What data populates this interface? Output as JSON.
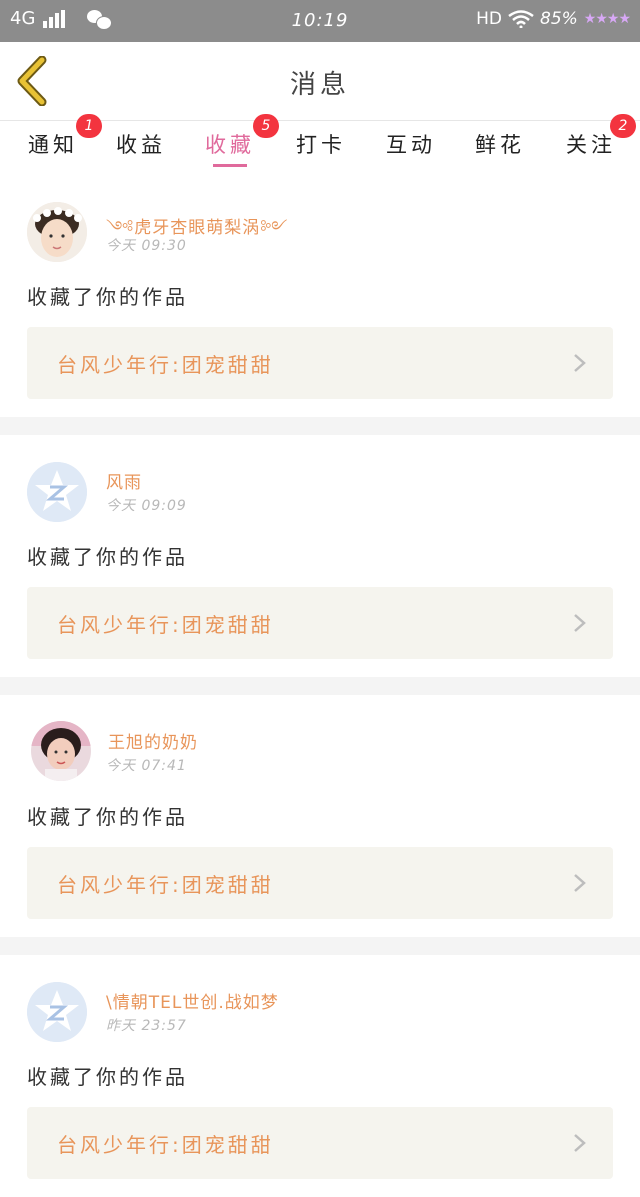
{
  "status_bar": {
    "network": "4G",
    "time": "10:19",
    "hd": "HD",
    "battery": "85%",
    "decoration": "★★★★"
  },
  "header": {
    "title": "消息"
  },
  "tabs": [
    {
      "label": "通知",
      "badge": "1"
    },
    {
      "label": "收益",
      "badge": ""
    },
    {
      "label": "收藏",
      "badge": "5",
      "active": true
    },
    {
      "label": "打卡",
      "badge": ""
    },
    {
      "label": "互动",
      "badge": ""
    },
    {
      "label": "鲜花",
      "badge": ""
    },
    {
      "label": "关注",
      "badge": "2"
    }
  ],
  "messages": [
    {
      "user": "༺虎牙杏眼萌梨涡༻",
      "time": "今天 09:30",
      "action": "收藏了你的作品",
      "work": "台风少年行:团宠甜甜",
      "avatar": "photo-boy"
    },
    {
      "user": "风雨",
      "time": "今天 09:09",
      "action": "收藏了你的作品",
      "work": "台风少年行:团宠甜甜",
      "avatar": "default"
    },
    {
      "user": "王旭的奶奶",
      "time": "今天 07:41",
      "action": "收藏了你的作品",
      "work": "台风少年行:团宠甜甜",
      "avatar": "photo-girl"
    },
    {
      "user": "\\情朝TEL世创.战如梦",
      "time": "昨天 23:57",
      "action": "收藏了你的作品",
      "work": "台风少年行:团宠甜甜",
      "avatar": "default"
    }
  ],
  "colors": {
    "accent": "#e06a9c",
    "username": "#e8955a",
    "badge": "#f3343f",
    "status_bar": "#8c8c8c",
    "back_arrow": "#d9b21e"
  }
}
